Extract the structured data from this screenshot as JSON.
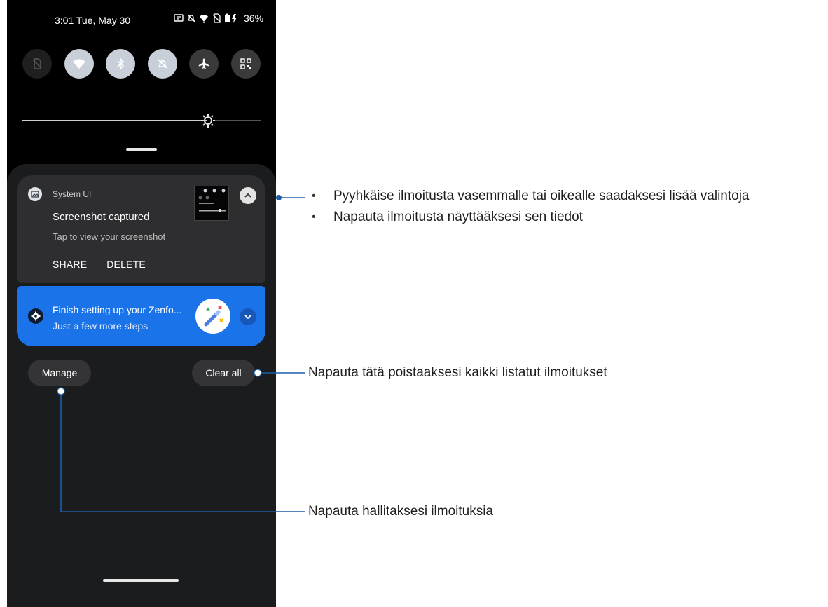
{
  "status_bar": {
    "time": "3:01",
    "date": "Tue, May 30",
    "battery": "36%"
  },
  "quick_settings": {
    "tiles": [
      {
        "name": "mobile-data-off-icon",
        "state": "off"
      },
      {
        "name": "wifi-icon",
        "state": "on"
      },
      {
        "name": "bluetooth-icon",
        "state": "on"
      },
      {
        "name": "do-not-disturb-icon",
        "state": "on"
      },
      {
        "name": "airplane-mode-icon",
        "state": "dim"
      },
      {
        "name": "qr-code-icon",
        "state": "dim"
      }
    ],
    "brightness_level": 0.78
  },
  "notifications": {
    "system_ui": {
      "app_name": "System UI",
      "title": "Screenshot captured",
      "text": "Tap to view your screenshot",
      "actions": [
        "SHARE",
        "DELETE"
      ]
    },
    "setup": {
      "title": "Finish setting up your Zenfo...",
      "text": "Just a few more steps"
    }
  },
  "footer": {
    "manage_label": "Manage",
    "clear_all_label": "Clear all"
  },
  "callouts": {
    "swipe": "Pyyhkäise ilmoitusta vasemmalle tai oikealle saadaksesi lisää valintoja",
    "tap": "Napauta ilmoitusta näyttääksesi sen tiedot",
    "clear_all": "Napauta tätä poistaaksesi kaikki listatut ilmoitukset",
    "manage": "Napauta hallitaksesi ilmoituksia",
    "bullet": "•"
  },
  "colors": {
    "accent": "#1a73e8",
    "callout_line": "#1a5ea8"
  }
}
